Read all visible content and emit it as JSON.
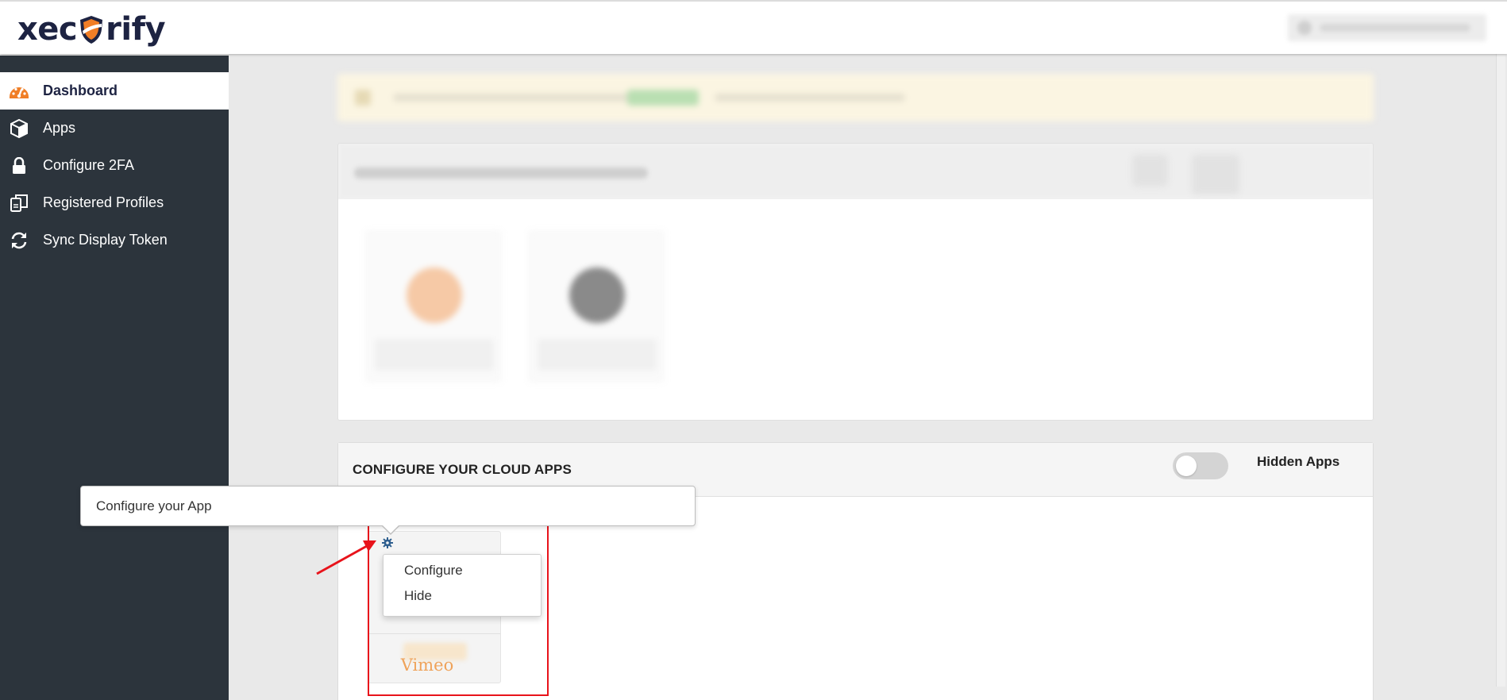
{
  "header": {
    "brand": {
      "prefix": "xec",
      "suffix": "rify",
      "icon": "shield-logo-icon"
    }
  },
  "sidebar": {
    "items": [
      {
        "label": "Dashboard",
        "icon": "dashboard-gauge-icon",
        "active": true
      },
      {
        "label": "Apps",
        "icon": "cube-icon",
        "active": false
      },
      {
        "label": "Configure 2FA",
        "icon": "lock-icon",
        "active": false
      },
      {
        "label": "Registered Profiles",
        "icon": "profiles-icon",
        "active": false
      },
      {
        "label": "Sync Display Token",
        "icon": "sync-icon",
        "active": false
      }
    ]
  },
  "cloud_apps": {
    "title": "CONFIGURE YOUR CLOUD APPS",
    "hidden_apps_label": "Hidden Apps",
    "hidden_apps_toggle": false,
    "app_card": {
      "name": "Vimeo",
      "icon": "gear-icon"
    }
  },
  "dropdown": {
    "items": [
      "Configure",
      "Hide"
    ]
  },
  "tooltip": {
    "text": "Configure your App"
  },
  "colors": {
    "sidebar_bg": "#2c343c",
    "brand_orange": "#f07e26",
    "brand_navy": "#1d2342",
    "highlight_red": "#e8131b",
    "vimeo_text": "#efa35a"
  }
}
